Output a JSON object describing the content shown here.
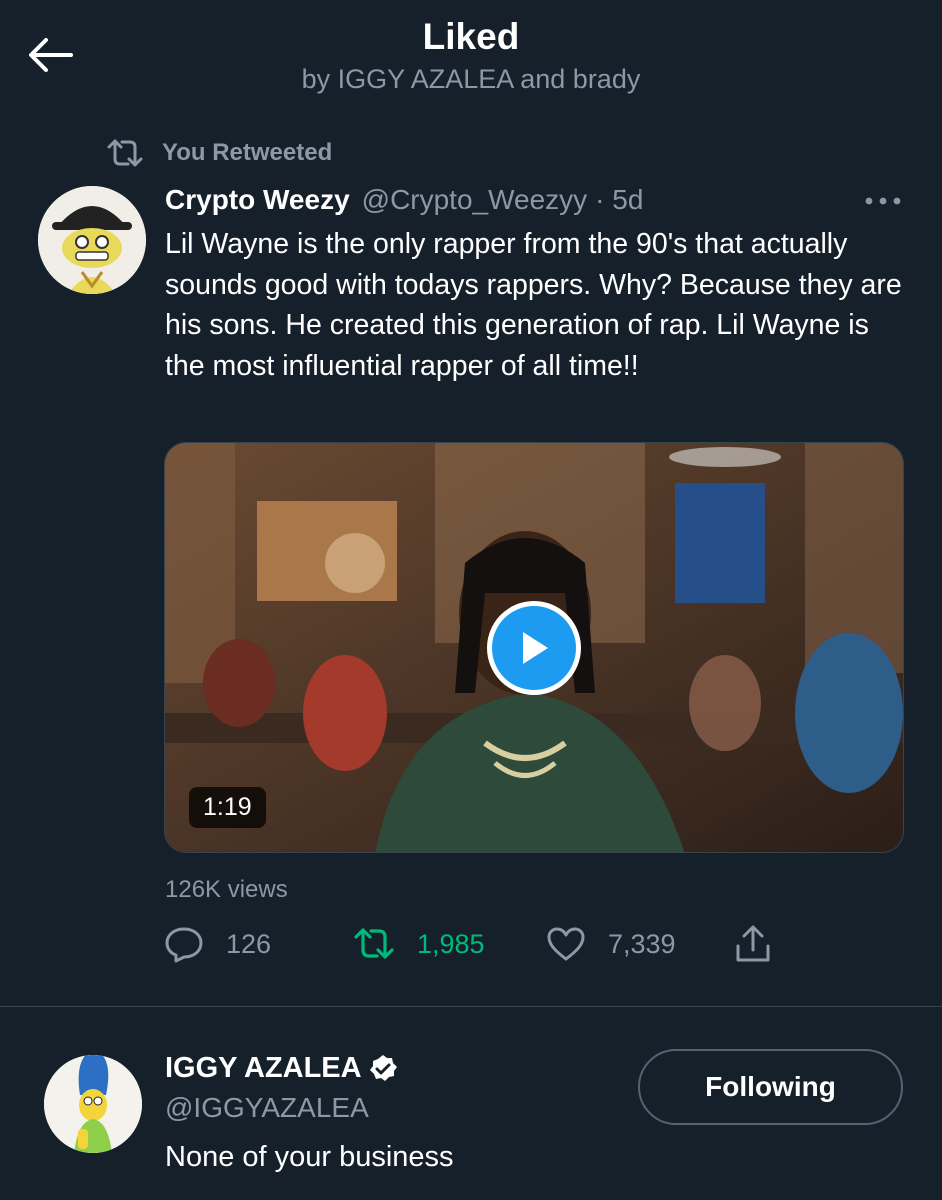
{
  "header": {
    "title": "Liked",
    "subtitle": "by IGGY AZALEA and brady",
    "back_icon": "arrow-left-icon"
  },
  "retweet_context": {
    "label": "You Retweeted",
    "icon": "retweet-icon"
  },
  "tweet": {
    "author_name": "Crypto Weezy",
    "author_handle": "@Crypto_Weezyy",
    "age": "· 5d",
    "text": "Lil Wayne is the only rapper from the 90's that actually sounds good with todays rappers. Why? Because they are his sons. He created this generation of rap. Lil Wayne is the most influential rapper of all time!!",
    "video": {
      "duration": "1:19"
    },
    "views": "126K views",
    "actions": {
      "replies": "126",
      "retweets": "1,985",
      "likes": "7,339"
    },
    "retweet_active_color": "#00ba7c"
  },
  "liker": {
    "name": "IGGY AZALEA",
    "handle": "@IGGYAZALEA",
    "bio": "None of your business",
    "follow_label": "Following",
    "verified": true
  },
  "colors": {
    "background": "#15202b",
    "muted_text": "#8b98a5",
    "accent_blue": "#1d9bf0",
    "divider": "#38444d"
  }
}
